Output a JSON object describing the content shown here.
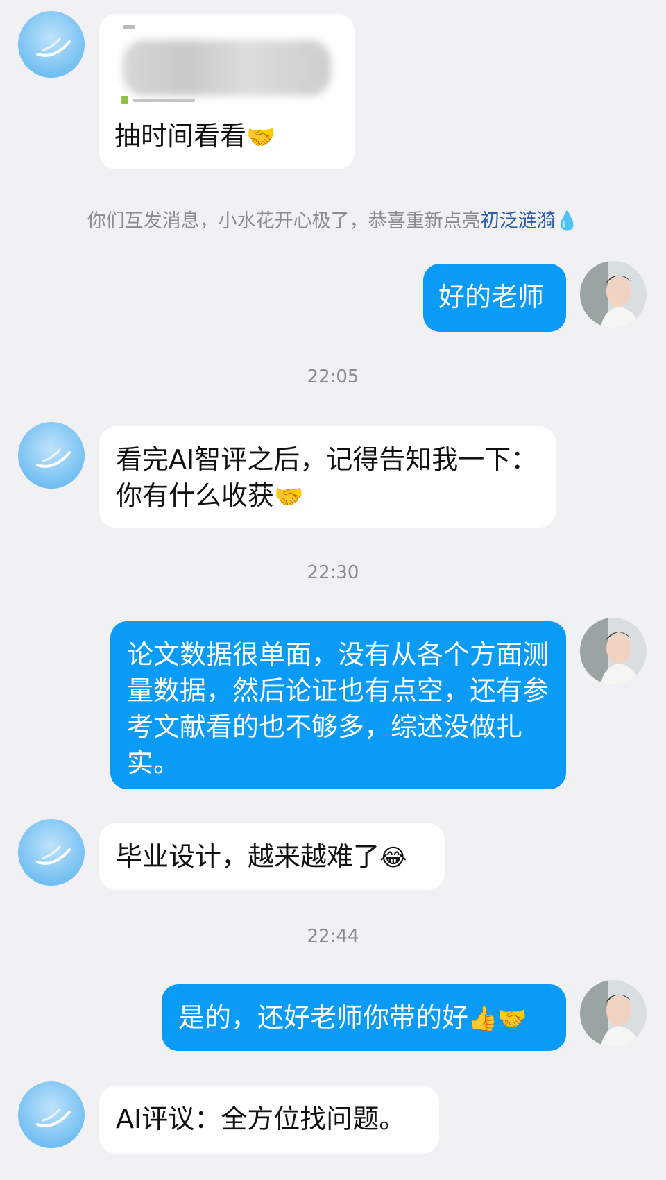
{
  "messages": {
    "m1_text": "抽时间看看",
    "m1_emoji": "🤝",
    "system_notice": "你们互发消息，小水花开心极了，恭喜重新点亮",
    "system_highlight": "初泛涟漪",
    "system_icon": "💧",
    "m2_text": "好的老师",
    "ts1": "22:05",
    "m3_text": "看完AI智评之后，记得告知我一下：你有什么收获",
    "m3_emoji": "🤝",
    "ts2": "22:30",
    "m4_text": "论文数据很单面，没有从各个方面测量数据，然后论证也有点空，还有参考文献看的也不够多，综述没做扎实。",
    "m5_text": "毕业设计，越来越难了",
    "m5_emoji": "😂",
    "ts3": "22:44",
    "m6_text": "是的，还好老师你带的好",
    "m6_emoji": "👍🤝",
    "m7_text": "AI评议：全方位找问题。"
  },
  "colors": {
    "background": "#f1f1f4",
    "incoming_bubble": "#ffffff",
    "outgoing_bubble": "#0a9bf6",
    "timestamp": "#8a8a8f",
    "highlight": "#2c5ba8"
  },
  "icons": {
    "teacher_avatar": "blue-sky-feather-avatar",
    "user_avatar": "person-portrait-avatar",
    "water-drop": "water-drop-icon"
  }
}
